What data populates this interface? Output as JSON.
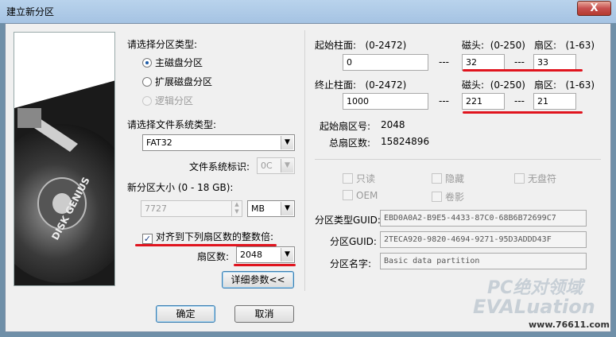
{
  "window": {
    "title": "建立新分区",
    "close_symbol": "X"
  },
  "side_image": {
    "brand": "DISK GENIUS"
  },
  "partition_type": {
    "heading": "请选择分区类型:",
    "options": [
      {
        "label": "主磁盘分区",
        "selected": true,
        "enabled": true
      },
      {
        "label": "扩展磁盘分区",
        "selected": false,
        "enabled": true
      },
      {
        "label": "逻辑分区",
        "selected": false,
        "enabled": false
      }
    ]
  },
  "filesystem": {
    "heading": "请选择文件系统类型:",
    "selected": "FAT32",
    "id_label": "文件系统标识:",
    "id_value": "0C"
  },
  "size": {
    "label": "新分区大小 (0 - 18 GB):",
    "value": "7727",
    "unit": "MB"
  },
  "align": {
    "checkbox_label": "对齐到下列扇区数的整数倍:",
    "checked": true,
    "sector_label": "扇区数:",
    "sector_value": "2048",
    "advanced_button": "详细参数<<"
  },
  "chs_start": {
    "cyl_label": "起始柱面:",
    "cyl_range": "(0-2472)",
    "cyl_value": "0",
    "head_label": "磁头:",
    "head_range": "(0-250)",
    "head_value": "32",
    "sector_label": "扇区:",
    "sector_range": "(1-63)",
    "sector_value": "33"
  },
  "chs_end": {
    "cyl_label": "终止柱面:",
    "cyl_range": "(0-2472)",
    "cyl_value": "1000",
    "head_label": "磁头:",
    "head_range": "(0-250)",
    "head_value": "221",
    "sector_label": "扇区:",
    "sector_range": "(1-63)",
    "sector_value": "21"
  },
  "separator": "---",
  "info": {
    "start_sector_label": "起始扇区号:",
    "start_sector_value": "2048",
    "total_sectors_label": "总扇区数:",
    "total_sectors_value": "15824896"
  },
  "attributes": {
    "readonly": "只读",
    "hidden": "隐藏",
    "no_drive_letter": "无盘符",
    "oem": "OEM",
    "shadow": "卷影"
  },
  "guid": {
    "type_label": "分区类型GUID:",
    "type_value": "EBD0A0A2-B9E5-4433-87C0-68B6B72699C7",
    "partition_label": "分区GUID:",
    "partition_value": "2TECA920-9820-4694-9271-95D3ADDD43F",
    "name_label": "分区名字:",
    "name_value": "Basic data partition"
  },
  "buttons": {
    "ok": "确定",
    "cancel": "取消"
  },
  "watermark": {
    "line1": "PC绝对领域",
    "line2": "EVALuation",
    "site": "www.76611.com"
  }
}
